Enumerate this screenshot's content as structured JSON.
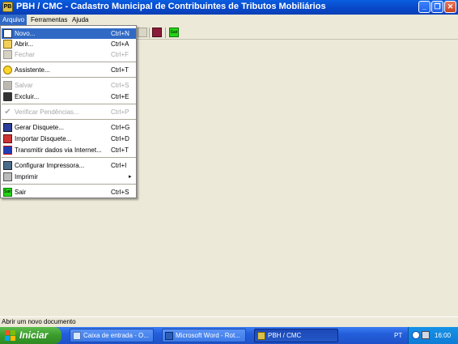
{
  "window": {
    "title": "PBH / CMC - Cadastro Municipal de Contribuintes de Tributos Mobiliários",
    "app_icon_text": "PB",
    "minimize_symbol": "_",
    "maximize_symbol": "❐",
    "close_symbol": "✕"
  },
  "menubar": {
    "items": [
      {
        "label": "Arquivo"
      },
      {
        "label": "Ferramentas"
      },
      {
        "label": "Ajuda"
      }
    ]
  },
  "toolbar": {
    "sair_label": "Sair"
  },
  "file_menu": {
    "items": [
      {
        "label": "Novo...",
        "shortcut": "Ctrl+N",
        "icon": "new-document-icon"
      },
      {
        "label": "Abrir...",
        "shortcut": "Ctrl+A",
        "icon": "open-folder-icon"
      },
      {
        "label": "Fechar",
        "shortcut": "Ctrl+F",
        "icon": "close-document-icon"
      },
      {
        "label": "Assistente...",
        "shortcut": "Ctrl+T",
        "icon": "lightbulb-icon"
      },
      {
        "label": "Salvar",
        "shortcut": "Ctrl+S",
        "icon": "save-icon"
      },
      {
        "label": "Excluir...",
        "shortcut": "Ctrl+E",
        "icon": "trash-icon"
      },
      {
        "label": "Verificar Pendências...",
        "shortcut": "Ctrl+P",
        "icon": "checkmark-icon"
      },
      {
        "label": "Gerar Disquete...",
        "shortcut": "Ctrl+G",
        "icon": "floppy-disk-icon"
      },
      {
        "label": "Importar Disquete...",
        "shortcut": "Ctrl+D",
        "icon": "import-disk-icon"
      },
      {
        "label": "Transmitir dados via Internet...",
        "shortcut": "Ctrl+T",
        "icon": "network-icon"
      },
      {
        "label": "Configurar Impressora...",
        "shortcut": "Ctrl+I",
        "icon": "printer-setup-icon"
      },
      {
        "label": "Imprimir",
        "submenu_arrow": "▸",
        "icon": "printer-icon"
      },
      {
        "label": "Sair",
        "shortcut": "Ctrl+S",
        "icon": "exit-icon",
        "icon_text": "Sair"
      }
    ]
  },
  "statusbar": {
    "text": "Abrir um novo documento"
  },
  "taskbar": {
    "start_label": "Iniciar",
    "tasks": [
      {
        "label": "Caixa de entrada - O..."
      },
      {
        "label": "Microsoft Word - Rot..."
      },
      {
        "label": "PBH / CMC"
      }
    ],
    "language": "PT",
    "clock": "16:00"
  }
}
